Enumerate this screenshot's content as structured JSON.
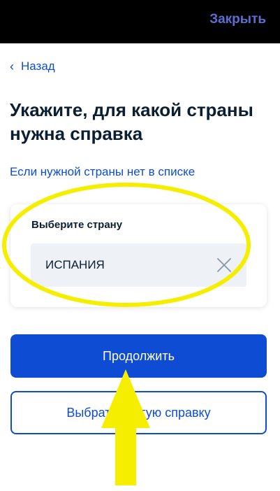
{
  "topbar": {
    "close_label": "Закрыть"
  },
  "nav": {
    "back_label": "Назад",
    "back_icon": "chevron-left-icon"
  },
  "page": {
    "title": "Укажите, для какой страны нужна справка",
    "hint_link": "Если нужной страны нет в списке"
  },
  "form": {
    "field_label": "Выберите страну",
    "selected_country": "ИСПАНИЯ",
    "clear_icon": "close-icon"
  },
  "actions": {
    "continue_label": "Продолжить",
    "secondary_label": "Выбрать другую справку"
  },
  "annotations": {
    "highlight_color": "#f5ee00",
    "shapes": [
      "ellipse-highlight",
      "arrow-up"
    ]
  },
  "colors": {
    "primary": "#0d4cd3",
    "text": "#0b1f33",
    "field_bg": "#eef1f5",
    "topbar_bg": "#000000",
    "close_link": "#5b6fd1"
  }
}
